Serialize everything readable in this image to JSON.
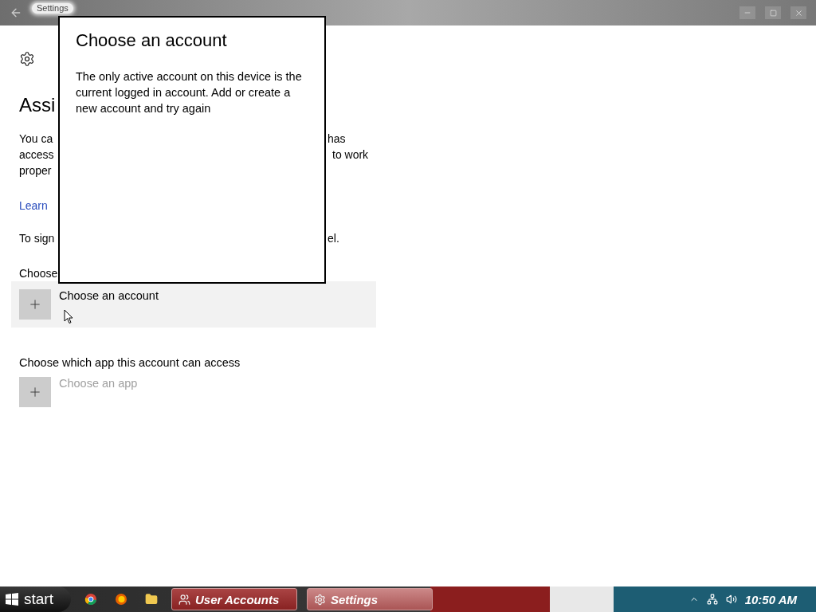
{
  "title_bar": {
    "title": "Settings"
  },
  "page": {
    "heading_fragment": "Assi",
    "paragraph_lines": [
      {
        "left": "You ca",
        "right": "has"
      },
      {
        "left": "access",
        "right": "to work"
      },
      {
        "left": "proper"
      }
    ],
    "link_fragment": "Learn",
    "sign_in_line": {
      "left": "To sign",
      "right": "el."
    },
    "account_label_fragment": "Choose",
    "account_picker": {
      "label": "Choose an account",
      "hovered": true,
      "disabled": false
    },
    "app_label": "Choose which app this account can access",
    "app_picker": {
      "label": "Choose an app",
      "hovered": false,
      "disabled": true
    }
  },
  "dialog": {
    "title": "Choose an account",
    "message": "The only active account on this device is the current logged in account. Add or create a new account and try again"
  },
  "taskbar": {
    "start": "start",
    "tasks": [
      {
        "label": "User Accounts",
        "kind": "accounts",
        "selected": false
      },
      {
        "label": "Settings",
        "kind": "settings",
        "selected": true
      }
    ],
    "clock": "10:50 AM"
  }
}
